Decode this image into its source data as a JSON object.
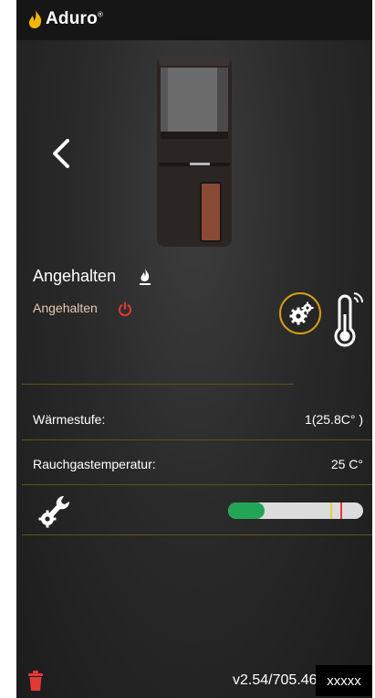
{
  "header": {
    "brand": "Aduro",
    "brand_mark": "®",
    "logo_icon": "flame-logo-icon"
  },
  "status": {
    "title": "Angehalten",
    "subtitle": "Angehalten"
  },
  "rows": [
    {
      "label": "Wärmestufe:",
      "value": "1(25.8C° )"
    },
    {
      "label": "Rauchgastemperatur:",
      "value": "25 C°"
    }
  ],
  "maintenance": {
    "progress_percent": 27,
    "markers_percent": [
      76,
      83
    ]
  },
  "footer": {
    "version": "v2.54/705.46/",
    "serial": "xxxxx"
  },
  "colors": {
    "accent_gold": "#d4a017",
    "status_red": "#e53935",
    "progress_green": "#23a558"
  }
}
